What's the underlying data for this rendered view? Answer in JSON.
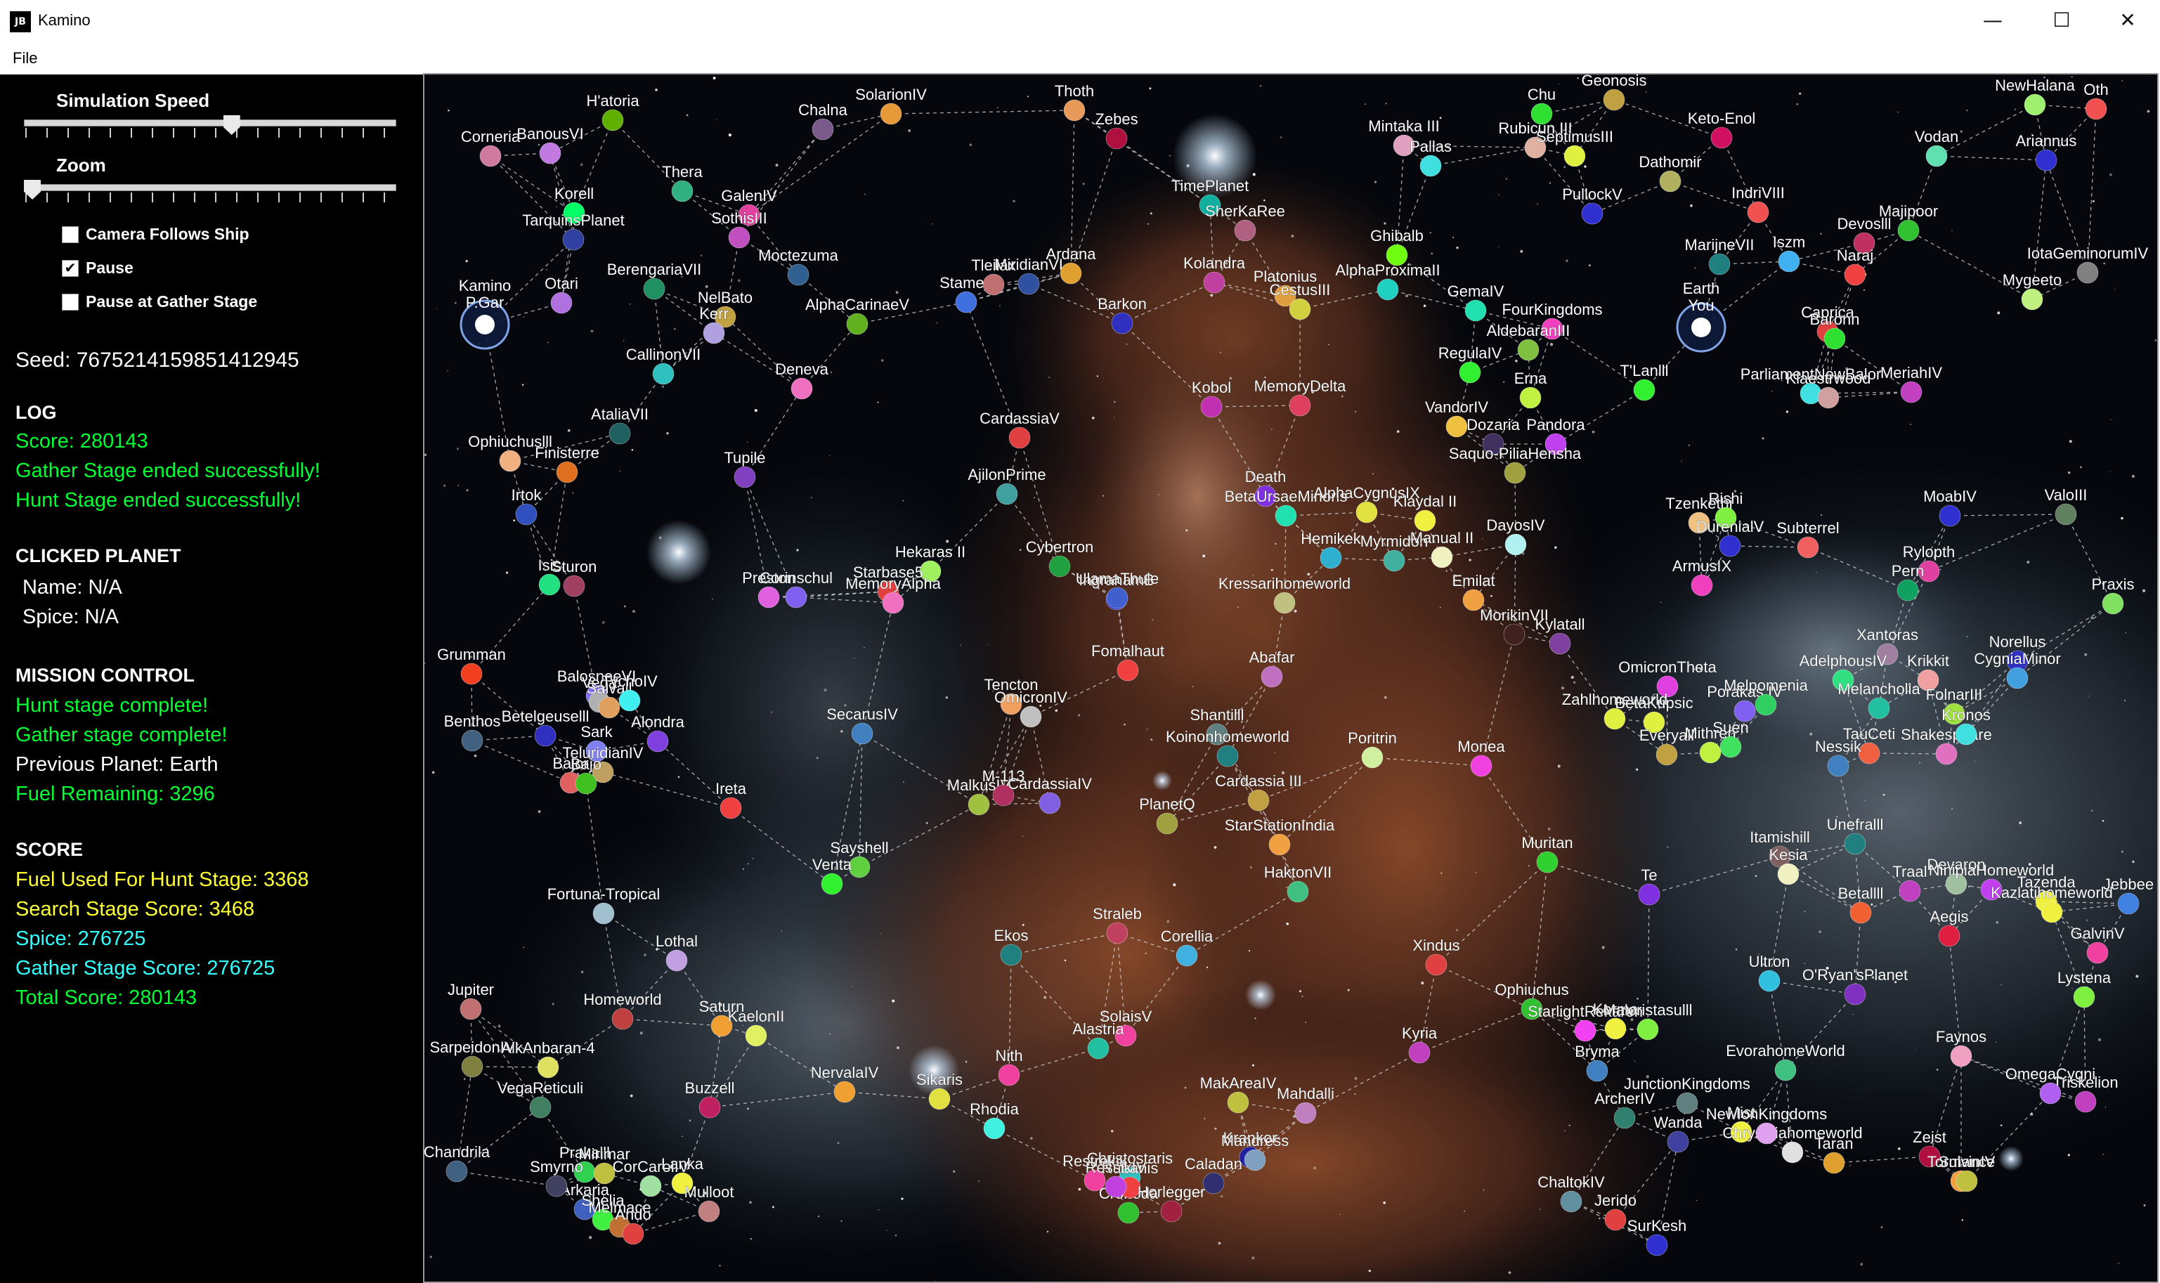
{
  "window": {
    "title": "Kamino",
    "icon": "jb-app-icon",
    "controls": [
      "minimize-icon",
      "maximize-icon",
      "close-icon"
    ]
  },
  "menu": {
    "file": "File"
  },
  "panel": {
    "sim_speed_label": "Simulation Speed",
    "sim_speed_value": 0.56,
    "zoom_label": "Zoom",
    "zoom_value": 0.0,
    "camera_follows_label": "Camera Follows Ship",
    "camera_follows_checked": false,
    "pause_label": "Pause",
    "pause_checked": true,
    "pause_gather_label": "Pause at Gather Stage",
    "pause_gather_checked": false,
    "seed": "Seed: 7675214159851412945",
    "log_heading": "LOG",
    "log_lines": [
      "Score: 280143",
      "Gather Stage ended successfully!",
      "Hunt Stage ended successfully!"
    ],
    "clicked_heading": "CLICKED PLANET",
    "clicked_name": "Name: N/A",
    "clicked_spice": "Spice: N/A",
    "mission_heading": "MISSION CONTROL",
    "mission_lines": [
      "Hunt stage complete!",
      "Gather stage complete!",
      "Previous Planet: Earth",
      "Fuel Remaining: 3296"
    ],
    "score_heading": "SCORE",
    "score_lines": [
      "Fuel Used For Hunt Stage: 3368",
      "Search Stage Score: 3468",
      "Spice: 276725",
      "Gather Stage Score: 276725",
      "Total Score: 280143"
    ]
  },
  "colors": {
    "log_green": "#00ff33",
    "score_yellow": "#ffff33",
    "score_cyan": "#33ffff",
    "edge": "#dcdcdc"
  },
  "map": {
    "special": [
      {
        "name": "Kamino",
        "label2": "P.Gar",
        "role": "ship-origin"
      },
      {
        "name": "Earth",
        "label2": "You",
        "role": "player"
      }
    ],
    "planets": [
      {
        "n": "H'atoria",
        "c": "#5fb000"
      },
      {
        "n": "Chalna",
        "c": "#7a5a8a"
      },
      {
        "n": "SolarionIV",
        "c": "#e69a3a"
      },
      {
        "n": "Thoth",
        "c": "#e89a5a"
      },
      {
        "n": "Zebes",
        "c": "#b01040"
      },
      {
        "n": "Corneria",
        "c": "#d07aa0"
      },
      {
        "n": "BanousVI",
        "c": "#c07ae0"
      },
      {
        "n": "Thera",
        "c": "#30b080"
      },
      {
        "n": "Korell",
        "c": "#00ff66"
      },
      {
        "n": "TarquinsPlanet",
        "c": "#3040a0"
      },
      {
        "n": "GalenIV",
        "c": "#e040a0"
      },
      {
        "n": "SothisIII",
        "c": "#c050c0"
      },
      {
        "n": "Moctezuma",
        "c": "#306090"
      },
      {
        "n": "BerengariaVII",
        "c": "#209060"
      },
      {
        "n": "Otari",
        "c": "#b070e0"
      },
      {
        "n": "NelBato",
        "c": "#c0a040"
      },
      {
        "n": "Kerr",
        "c": "#b0a0e0"
      },
      {
        "n": "CallinonVII",
        "c": "#30c0c0"
      },
      {
        "n": "Deneva",
        "c": "#f070c0"
      },
      {
        "n": "AlphaCarinaeV",
        "c": "#60b020"
      },
      {
        "n": "Stamen",
        "c": "#4070e0"
      },
      {
        "n": "Tleilax",
        "c": "#c07070"
      },
      {
        "n": "MiridianVI",
        "c": "#3050a0"
      },
      {
        "n": "Ardana",
        "c": "#e0a030"
      },
      {
        "n": "Barkon",
        "c": "#3030c0"
      },
      {
        "n": "Kolandra",
        "c": "#c040a0"
      },
      {
        "n": "TimePlanet",
        "c": "#10b0a0"
      },
      {
        "n": "SherKaRee",
        "c": "#b06080"
      },
      {
        "n": "Platonius",
        "c": "#e0a040"
      },
      {
        "n": "CestusIII",
        "c": "#d0d040"
      },
      {
        "n": "AlphaProximaII",
        "c": "#20d0c0"
      },
      {
        "n": "Ghibalb",
        "c": "#70ff10"
      },
      {
        "n": "GemaIV",
        "c": "#20e0b0"
      },
      {
        "n": "Mintaka III",
        "c": "#e0a0c0"
      },
      {
        "n": "Pallas",
        "c": "#40e0e0"
      },
      {
        "n": "Chu",
        "c": "#30e030"
      },
      {
        "n": "Rubicun III",
        "c": "#e0b0a0"
      },
      {
        "n": "SeptimusIII",
        "c": "#e0f040"
      },
      {
        "n": "Geonosis",
        "c": "#c0a040"
      },
      {
        "n": "Keto-Enol",
        "c": "#d01060"
      },
      {
        "n": "Dathomir",
        "c": "#b0b060"
      },
      {
        "n": "PullockV",
        "c": "#3030d0"
      },
      {
        "n": "NewHalana",
        "c": "#a0f070"
      },
      {
        "n": "Oth",
        "c": "#f05050"
      },
      {
        "n": "Vodan",
        "c": "#60e0b0"
      },
      {
        "n": "Ariannus",
        "c": "#3030d0"
      },
      {
        "n": "IndriVIII",
        "c": "#f05050"
      },
      {
        "n": "MarijneVII",
        "c": "#208080"
      },
      {
        "n": "Iszm",
        "c": "#40b0f0"
      },
      {
        "n": "Devoslll",
        "c": "#c03060"
      },
      {
        "n": "Majipoor",
        "c": "#30c030"
      },
      {
        "n": "IotaGeminorumIV",
        "c": "#808080"
      },
      {
        "n": "Mygeeto",
        "c": "#c0f080"
      },
      {
        "n": "Naraj",
        "c": "#f04040"
      },
      {
        "n": "Caprica",
        "c": "#e04040"
      },
      {
        "n": "Baronn",
        "c": "#30e030"
      },
      {
        "n": "Kobol",
        "c": "#c030b0"
      },
      {
        "n": "MemoryDelta",
        "c": "#e04060"
      },
      {
        "n": "CardassiaV",
        "c": "#e04040"
      },
      {
        "n": "Ophiuchuslll",
        "c": "#f0b080"
      },
      {
        "n": "Finisterre",
        "c": "#e07020"
      },
      {
        "n": "AtaliaVII",
        "c": "#206060"
      },
      {
        "n": "Tupile",
        "c": "#8040c0"
      },
      {
        "n": "AjilonPrime",
        "c": "#40a0a0"
      },
      {
        "n": "Irtok",
        "c": "#3050c0"
      },
      {
        "n": "Hekaras II",
        "c": "#a0f060"
      },
      {
        "n": "Cybertron",
        "c": "#20a040"
      },
      {
        "n": "IngrahamB",
        "c": "#3030c0"
      },
      {
        "n": "Death",
        "c": "#8030e0"
      },
      {
        "n": "BetaUrsaeMinoris",
        "c": "#20e0b0"
      },
      {
        "n": "AlphaCygnusIX",
        "c": "#e0e040"
      },
      {
        "n": "Klaydal II",
        "c": "#f0f040"
      },
      {
        "n": "Hemikek",
        "c": "#30b0d0"
      },
      {
        "n": "Myrmidon",
        "c": "#40b0a0"
      },
      {
        "n": "Manual II",
        "c": "#f0f0c0"
      },
      {
        "n": "DayosIV",
        "c": "#b0f0f0"
      },
      {
        "n": "VandorIV",
        "c": "#f0c040"
      },
      {
        "n": "Dozaria",
        "c": "#403060"
      },
      {
        "n": "Pandora",
        "c": "#c040f0"
      },
      {
        "n": "Saquo-PiliaHensha",
        "c": "#a0a040"
      },
      {
        "n": "RegulaIV",
        "c": "#30f030"
      },
      {
        "n": "Erna",
        "c": "#c0f040"
      },
      {
        "n": "FourKingdoms",
        "c": "#f040c0"
      },
      {
        "n": "AldebaranIII",
        "c": "#80c040"
      },
      {
        "n": "T'Lanlll",
        "c": "#30f030"
      },
      {
        "n": "ParliamentNewBalor",
        "c": "#40e0e0"
      },
      {
        "n": "Klaestrwood",
        "c": "#d0a0a0"
      },
      {
        "n": "MeriahIV",
        "c": "#c040c0"
      },
      {
        "n": "Tzenkethi",
        "c": "#f0c080"
      },
      {
        "n": "Rishi",
        "c": "#80f040"
      },
      {
        "n": "DurenialV",
        "c": "#3030d0"
      },
      {
        "n": "ArmusIX",
        "c": "#f040c0"
      },
      {
        "n": "Subterrel",
        "c": "#f06060"
      },
      {
        "n": "MoabIV",
        "c": "#3030d0"
      },
      {
        "n": "ValoIII",
        "c": "#608060"
      },
      {
        "n": "Praxis",
        "c": "#80e060"
      },
      {
        "n": "Rylopth",
        "c": "#e040a0"
      },
      {
        "n": "Pern",
        "c": "#10a060"
      },
      {
        "n": "Isis",
        "c": "#20e080"
      },
      {
        "n": "Sturon",
        "c": "#a04060"
      },
      {
        "n": "Preston",
        "c": "#e060e0"
      },
      {
        "n": "Corinschul",
        "c": "#8060f0"
      },
      {
        "n": "Starbase5",
        "c": "#e04040"
      },
      {
        "n": "MemoryAlpha",
        "c": "#f070c0"
      },
      {
        "n": "UlamaThule",
        "c": "#4060d0"
      },
      {
        "n": "Kressarihomeworld",
        "c": "#c0c080"
      },
      {
        "n": "Emilat",
        "c": "#f0a040"
      },
      {
        "n": "MorikinVII",
        "c": "#402020"
      },
      {
        "n": "Kylatall",
        "c": "#8040a0"
      },
      {
        "n": "Xantoras",
        "c": "#a080a0"
      },
      {
        "n": "Norellus",
        "c": "#3030c0"
      },
      {
        "n": "AdelphousIV",
        "c": "#30e080"
      },
      {
        "n": "Krikkit",
        "c": "#f0a0a0"
      },
      {
        "n": "CygniaMinor",
        "c": "#40a0e0"
      },
      {
        "n": "Grumman",
        "c": "#f04020"
      },
      {
        "n": "BalosneeVI",
        "c": "#8070f0"
      },
      {
        "n": "Vega",
        "c": "#b0b0b0"
      },
      {
        "n": "Salvall",
        "c": "#e0a060"
      },
      {
        "n": "TychoIV",
        "c": "#40f0f0"
      },
      {
        "n": "Fomalhaut",
        "c": "#f04040"
      },
      {
        "n": "Abafar",
        "c": "#c070c0"
      },
      {
        "n": "Tencton",
        "c": "#f0a060"
      },
      {
        "n": "OmicronIV",
        "c": "#c0c0c0"
      },
      {
        "n": "OmicronTheta",
        "c": "#e040e0"
      },
      {
        "n": "Zahlhomeworld",
        "c": "#e0f040"
      },
      {
        "n": "Porakas IV",
        "c": "#8060f0"
      },
      {
        "n": "Melpomenia",
        "c": "#30d060"
      },
      {
        "n": "Melancholia",
        "c": "#20c0a0"
      },
      {
        "n": "FolnarIII",
        "c": "#a0e040"
      },
      {
        "n": "Benthos",
        "c": "#406080"
      },
      {
        "n": "Betelgeuselll",
        "c": "#3030c0"
      },
      {
        "n": "Sark",
        "c": "#8080f0"
      },
      {
        "n": "Alondra",
        "c": "#8040e0"
      },
      {
        "n": "TeluridianIV",
        "c": "#c0a060"
      },
      {
        "n": "Bajor",
        "c": "#e06060"
      },
      {
        "n": "Bajo",
        "c": "#40c020"
      },
      {
        "n": "SecarusIV",
        "c": "#4080c0"
      },
      {
        "n": "Shantilll",
        "c": "#608080"
      },
      {
        "n": "Koinonhomeworld",
        "c": "#208080"
      },
      {
        "n": "Poritrin",
        "c": "#d0f0a0"
      },
      {
        "n": "Cardassia III",
        "c": "#c0a040"
      },
      {
        "n": "Monea",
        "c": "#f040e0"
      },
      {
        "n": "BetaKupsic",
        "c": "#e0f040"
      },
      {
        "n": "Everyall",
        "c": "#c0a040"
      },
      {
        "n": "Mithren",
        "c": "#c0f040"
      },
      {
        "n": "Suen",
        "c": "#40e060"
      },
      {
        "n": "TauCeti",
        "c": "#f06040"
      },
      {
        "n": "Shakespeare",
        "c": "#e070c0"
      },
      {
        "n": "Kronos",
        "c": "#40e0e0"
      },
      {
        "n": "Nessik",
        "c": "#4080c0"
      },
      {
        "n": "Ireta",
        "c": "#f04040"
      },
      {
        "n": "MalkusIV",
        "c": "#a0c040"
      },
      {
        "n": "M-113",
        "c": "#b03060"
      },
      {
        "n": "CardassiaIV",
        "c": "#8060e0"
      },
      {
        "n": "PlanetQ",
        "c": "#a0a040"
      },
      {
        "n": "StarStationIndia",
        "c": "#f0a040"
      },
      {
        "n": "Sayshell",
        "c": "#60d040"
      },
      {
        "n": "Venta",
        "c": "#30f030"
      },
      {
        "n": "Fortuna-Tropical",
        "c": "#a0c0d0"
      },
      {
        "n": "HaktonVII",
        "c": "#40c080"
      },
      {
        "n": "Muritan",
        "c": "#30d030"
      },
      {
        "n": "Itamishill",
        "c": "#806060"
      },
      {
        "n": "Kesia",
        "c": "#f0f0c0"
      },
      {
        "n": "Unefralll",
        "c": "#208080"
      },
      {
        "n": "Te",
        "c": "#8030e0"
      },
      {
        "n": "Betallll",
        "c": "#f06030"
      },
      {
        "n": "Traal",
        "c": "#c040c0"
      },
      {
        "n": "Devaron",
        "c": "#a0c0a0"
      },
      {
        "n": "NinipiaHomeworld",
        "c": "#c040f0"
      },
      {
        "n": "Tazenda",
        "c": "#f0f040"
      },
      {
        "n": "Kazlatihomeworld",
        "c": "#f0f040"
      },
      {
        "n": "Jebbee",
        "c": "#4080e0"
      },
      {
        "n": "Aegis",
        "c": "#e02040"
      },
      {
        "n": "GalvinV",
        "c": "#f040a0"
      },
      {
        "n": "Lothal",
        "c": "#c0a0e0"
      },
      {
        "n": "Ekos",
        "c": "#208080"
      },
      {
        "n": "Straleb",
        "c": "#c04060"
      },
      {
        "n": "Corellia",
        "c": "#40b0e0"
      },
      {
        "n": "Xindus",
        "c": "#e04040"
      },
      {
        "n": "Ultron",
        "c": "#30c0e0"
      },
      {
        "n": "O'Ryan'sPlanet",
        "c": "#8030c0"
      },
      {
        "n": "Lystena",
        "c": "#80f040"
      },
      {
        "n": "Jupiter",
        "c": "#c07070"
      },
      {
        "n": "Homeworld",
        "c": "#c04040"
      },
      {
        "n": "Saturn",
        "c": "#f0a030"
      },
      {
        "n": "KaelonII",
        "c": "#e0f060"
      },
      {
        "n": "SolaisV",
        "c": "#f040a0"
      },
      {
        "n": "Alastria",
        "c": "#20c0a0"
      },
      {
        "n": "Ophiuchus",
        "c": "#30c030"
      },
      {
        "n": "StarlightRekaren",
        "c": "#f040f0"
      },
      {
        "n": "Korma",
        "c": "#f0f040"
      },
      {
        "n": "Maloristasulll",
        "c": "#80f040"
      },
      {
        "n": "Kyria",
        "c": "#c040c0"
      },
      {
        "n": "Bryma",
        "c": "#4080c0"
      },
      {
        "n": "EvorahomeWorld",
        "c": "#40c080"
      },
      {
        "n": "Faynos",
        "c": "#f0a0c0"
      },
      {
        "n": "Triskelion",
        "c": "#c040c0"
      },
      {
        "n": "OmegaCygni",
        "c": "#b060f0"
      },
      {
        "n": "SarpeidonIV",
        "c": "#808040"
      },
      {
        "n": "AlkAnbaran-4",
        "c": "#e0e060"
      },
      {
        "n": "VegaReticuli",
        "c": "#408060"
      },
      {
        "n": "Buzzell",
        "c": "#c02060"
      },
      {
        "n": "Nith",
        "c": "#f040a0"
      },
      {
        "n": "NervalaIV",
        "c": "#f0a030"
      },
      {
        "n": "Sikaris",
        "c": "#e0e040"
      },
      {
        "n": "Rhodia",
        "c": "#40f0e0"
      },
      {
        "n": "MakAreaIV",
        "c": "#c0c040"
      },
      {
        "n": "Mahdalli",
        "c": "#c080c0"
      },
      {
        "n": "Wanda",
        "c": "#4040a0"
      },
      {
        "n": "Mist",
        "c": "#f0f040"
      },
      {
        "n": "Chrysaliahomeworld",
        "c": "#e0e0e0"
      },
      {
        "n": "Zeist",
        "c": "#b01040"
      },
      {
        "n": "Tormance",
        "c": "#f0a040"
      },
      {
        "n": "SulvinIV",
        "c": "#c0c040"
      },
      {
        "n": "Chandrila",
        "c": "#406080"
      },
      {
        "n": "Prakalll",
        "c": "#30d050"
      },
      {
        "n": "Mirimar",
        "c": "#c0c040"
      },
      {
        "n": "Arkaria",
        "c": "#4060c0"
      },
      {
        "n": "Shelia",
        "c": "#40f040"
      },
      {
        "n": "Melmace",
        "c": "#c07030"
      },
      {
        "n": "Taran",
        "c": "#e0a030"
      },
      {
        "n": "ArcherIV",
        "c": "#308070"
      },
      {
        "n": "JunctionKingdoms",
        "c": "#608080"
      },
      {
        "n": "NewIonKingdoms",
        "c": "#e0a0f0"
      },
      {
        "n": "ChaltokIV",
        "c": "#6090a0"
      },
      {
        "n": "Smyrno",
        "c": "#404060"
      },
      {
        "n": "CorCarolIV",
        "c": "#a0e0a0"
      },
      {
        "n": "Lanka",
        "c": "#f0f040"
      },
      {
        "n": "Mulloot",
        "c": "#c08080"
      },
      {
        "n": "Cronoda",
        "c": "#30c030"
      },
      {
        "n": "Christostaris",
        "c": "#30c0c0"
      },
      {
        "n": "Rubanis",
        "c": "#f04040"
      },
      {
        "n": "Restrekik",
        "c": "#f040a0"
      },
      {
        "n": "RessikIV",
        "c": "#c040e0"
      },
      {
        "n": "Caladan",
        "c": "#303070"
      },
      {
        "n": "Krankor",
        "c": "#2020a0"
      },
      {
        "n": "Mandress",
        "c": "#80a0c0"
      },
      {
        "n": "Horlegger",
        "c": "#a02040"
      },
      {
        "n": "Ando",
        "c": "#e04040"
      },
      {
        "n": "Jerido",
        "c": "#e04040"
      },
      {
        "n": "SurKesh",
        "c": "#3030d0"
      }
    ]
  }
}
